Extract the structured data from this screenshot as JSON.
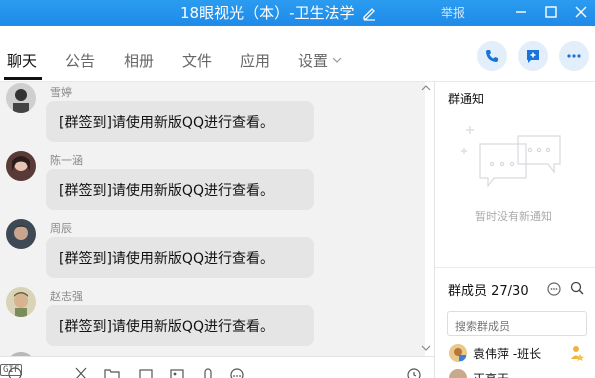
{
  "window": {
    "title": "18眼视光（本）-卫生法学",
    "report_label": "举报",
    "colors": {
      "titlebar": "#1f8ae8",
      "accent": "#1a73d9"
    }
  },
  "tabs": [
    {
      "label": "聊天",
      "active": true
    },
    {
      "label": "公告",
      "active": false
    },
    {
      "label": "相册",
      "active": false
    },
    {
      "label": "文件",
      "active": false
    },
    {
      "label": "应用",
      "active": false
    },
    {
      "label": "设置",
      "active": false
    }
  ],
  "header_actions": [
    {
      "icon": "phone-icon"
    },
    {
      "icon": "add-chat-icon"
    },
    {
      "icon": "more-icon"
    }
  ],
  "messages": [
    {
      "sender": "雪婷",
      "text": "[群签到]请使用新版QQ进行查看。"
    },
    {
      "sender": "陈一涵",
      "text": "[群签到]请使用新版QQ进行查看。"
    },
    {
      "sender": "周辰",
      "text": "[群签到]请使用新版QQ进行查看。"
    },
    {
      "sender": "赵志强",
      "text": "[群签到]请使用新版QQ进行查看。"
    }
  ],
  "toolbar": {
    "gif_label": "GIF",
    "icons": [
      "emoji-icon",
      "gif-icon",
      "scissors-icon",
      "folder-icon",
      "image-search-icon",
      "picture-icon",
      "mic-icon",
      "more-tools-icon",
      "history-icon"
    ]
  },
  "notice": {
    "title": "群通知",
    "empty_text": "暂时没有新通知"
  },
  "members": {
    "title": "群成员 27/30",
    "search_placeholder": "搜索群成员",
    "list": [
      {
        "name": "袁伟萍 -班长",
        "badge": "owner-crown-icon"
      },
      {
        "name": "正高天 ..."
      }
    ]
  }
}
